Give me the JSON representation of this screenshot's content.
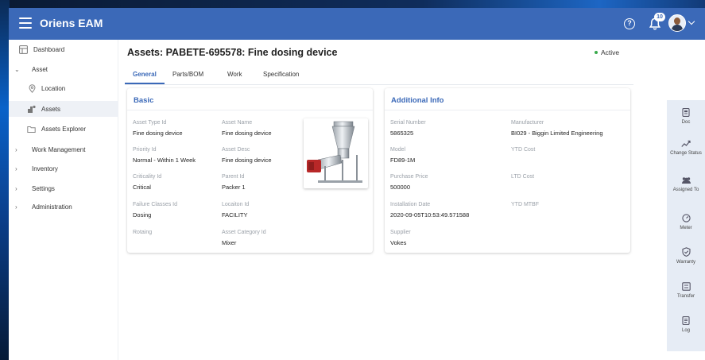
{
  "app": {
    "title": "Oriens EAM",
    "accent": "#3b69b8"
  },
  "header": {
    "notification_count": "10"
  },
  "sidebar": {
    "items": [
      {
        "label": "Dashboard",
        "icon": "dashboard-icon"
      },
      {
        "label": "Asset",
        "icon": "chevron-down-icon",
        "expanded": true
      },
      {
        "label": "Location",
        "icon": "location-pin-icon"
      },
      {
        "label": "Assets",
        "icon": "assets-icon",
        "active": true
      },
      {
        "label": "Assets Explorer",
        "icon": "folder-icon"
      },
      {
        "label": "Work Management",
        "icon": "chevron-right-icon"
      },
      {
        "label": "Inventory",
        "icon": "chevron-right-icon"
      },
      {
        "label": "Settings",
        "icon": "chevron-right-icon"
      },
      {
        "label": "Administration",
        "icon": "chevron-right-icon"
      }
    ]
  },
  "page": {
    "title": "Assets: PABETE-695578: Fine dosing device",
    "status": "Active",
    "status_color": "#3aaa4c"
  },
  "tabs": [
    "General",
    "Parts/BOM",
    "Work",
    "Specification"
  ],
  "basic": {
    "title": "Basic",
    "fields": [
      {
        "label": "Asset Type Id",
        "value": "Fine dosing device"
      },
      {
        "label": "Asset Name",
        "value": "Fine dosing device"
      },
      {
        "label": "Priority Id",
        "value": "Normal - Within 1 Week"
      },
      {
        "label": "Asset Desc",
        "value": "Fine dosing device"
      },
      {
        "label": "Criticality Id",
        "value": "Critical"
      },
      {
        "label": "Parent Id",
        "value": "Packer 1"
      },
      {
        "label": "Failure Classes Id",
        "value": "Dosing"
      },
      {
        "label": "Locaiton Id",
        "value": "FACILITY"
      },
      {
        "label": "Rotaing",
        "value": ""
      },
      {
        "label": "Asset Category Id",
        "value": "Mixer"
      }
    ]
  },
  "additional": {
    "title": "Additional Info",
    "fields": [
      {
        "label": "Serial Number",
        "value": "5865325"
      },
      {
        "label": "Manufacturer",
        "value": "BI029 - Biggin Limited Engineering"
      },
      {
        "label": "Model",
        "value": "FD89-1M"
      },
      {
        "label": "YTD Cost",
        "value": ""
      },
      {
        "label": "Purchase Price",
        "value": "500000"
      },
      {
        "label": "LTD Cost",
        "value": ""
      },
      {
        "label": "Installation Date",
        "value": "2020-09-05T10:53:49.571588"
      },
      {
        "label": "YTD MTBF",
        "value": ""
      },
      {
        "label": "Supplier",
        "value": "Vokes"
      }
    ]
  },
  "actions": [
    {
      "label": "Doc",
      "icon": "document-icon"
    },
    {
      "label": "Change Status",
      "icon": "trend-icon"
    },
    {
      "label": "Assigned To",
      "icon": "people-icon"
    },
    {
      "label": "Meter",
      "icon": "gauge-icon"
    },
    {
      "label": "Warranty",
      "icon": "shield-check-icon"
    },
    {
      "label": "Transfer",
      "icon": "transfer-icon"
    },
    {
      "label": "Log",
      "icon": "log-icon"
    }
  ]
}
